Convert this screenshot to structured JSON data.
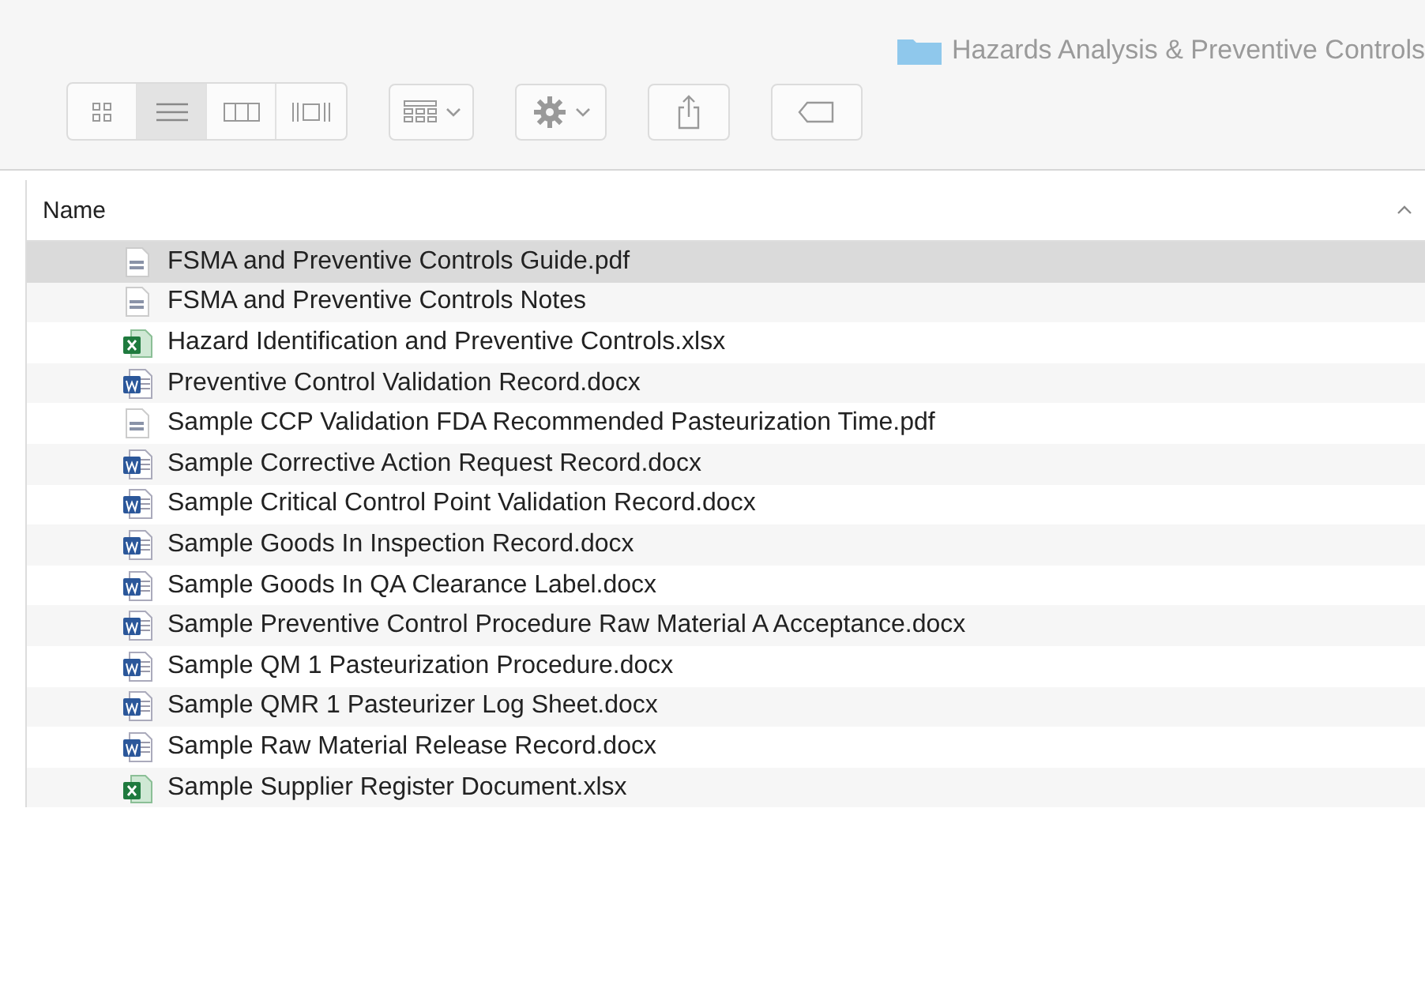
{
  "window": {
    "title": "Hazards Analysis & Preventive Controls"
  },
  "toolbar": {
    "view_modes": [
      {
        "kind": "icons",
        "selected": false
      },
      {
        "kind": "list",
        "selected": true
      },
      {
        "kind": "columns",
        "selected": false
      },
      {
        "kind": "gallery",
        "selected": false
      }
    ],
    "buttons": [
      {
        "kind": "group"
      },
      {
        "kind": "action"
      },
      {
        "kind": "share"
      },
      {
        "kind": "tag"
      }
    ]
  },
  "table": {
    "columns": [
      {
        "label": "Name"
      }
    ],
    "rows": [
      {
        "name": "FSMA and Preventive Controls Guide.pdf",
        "kind": "pdf",
        "selected": true
      },
      {
        "name": "FSMA and Preventive Controls Notes",
        "kind": "pdf",
        "selected": false
      },
      {
        "name": "Hazard Identification and Preventive Controls.xlsx",
        "kind": "xlsx",
        "selected": false
      },
      {
        "name": "Preventive Control Validation Record.docx",
        "kind": "docx",
        "selected": false
      },
      {
        "name": "Sample CCP Validation FDA Recommended Pasteurization Time.pdf",
        "kind": "pdf",
        "selected": false
      },
      {
        "name": "Sample Corrective Action Request Record.docx",
        "kind": "docx",
        "selected": false
      },
      {
        "name": "Sample Critical Control Point Validation Record.docx",
        "kind": "docx",
        "selected": false
      },
      {
        "name": "Sample Goods In Inspection Record.docx",
        "kind": "docx",
        "selected": false
      },
      {
        "name": "Sample Goods In QA Clearance Label.docx",
        "kind": "docx",
        "selected": false
      },
      {
        "name": "Sample Preventive Control Procedure Raw Material A Acceptance.docx",
        "kind": "docx",
        "selected": false
      },
      {
        "name": "Sample QM 1 Pasteurization Procedure.docx",
        "kind": "docx",
        "selected": false
      },
      {
        "name": "Sample QMR 1 Pasteurizer Log Sheet.docx",
        "kind": "docx",
        "selected": false
      },
      {
        "name": "Sample Raw Material Release Record.docx",
        "kind": "docx",
        "selected": false
      },
      {
        "name": "Sample Supplier Register Document.xlsx",
        "kind": "xlsx",
        "selected": false
      }
    ]
  }
}
